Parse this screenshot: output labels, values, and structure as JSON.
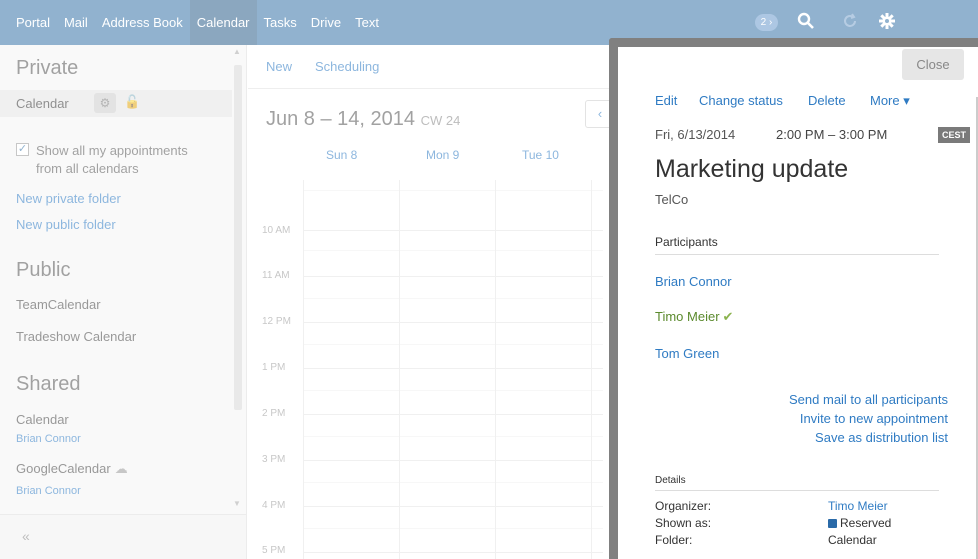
{
  "topbar": {
    "apps": [
      "Portal",
      "Mail",
      "Address Book",
      "Calendar",
      "Tasks",
      "Drive",
      "Text"
    ],
    "active_app": "Calendar",
    "notification_count": "2 ›",
    "icons": [
      "search-icon",
      "refresh-icon",
      "gear-icon"
    ]
  },
  "sidebar": {
    "private_heading": "Private",
    "calendar_label": "Calendar",
    "show_all_label": "Show all my appointments from all calendars",
    "show_all_checked": true,
    "new_private_folder": "New private folder",
    "new_public_folder": "New public folder",
    "public_heading": "Public",
    "public_items": [
      "TeamCalendar",
      "Tradeshow Calendar"
    ],
    "shared_heading": "Shared",
    "shared_items": [
      {
        "name": "Calendar",
        "owner": "Brian Connor"
      },
      {
        "name": "GoogleCalendar",
        "owner": "Brian Connor"
      }
    ],
    "collapse_label": "«"
  },
  "main": {
    "toolbar": {
      "new_label": "New",
      "scheduling_label": "Scheduling"
    },
    "range": "Jun 8 – 14, 2014",
    "cw": "CW 24",
    "days": [
      "Sun 8",
      "Mon 9",
      "Tue 10"
    ],
    "hours": [
      "10 AM",
      "11 AM",
      "12 PM",
      "1 PM",
      "2 PM",
      "3 PM",
      "4 PM",
      "5 PM"
    ],
    "prev_label": "‹"
  },
  "popup": {
    "close_label": "Close",
    "actions": {
      "edit": "Edit",
      "change_status": "Change status",
      "delete": "Delete",
      "more": "More ▾"
    },
    "date": "Fri, 6/13/2014",
    "time": "2:00 PM – 3:00 PM",
    "tz": "CEST",
    "title": "Marketing update",
    "location": "TelCo",
    "participants_heading": "Participants",
    "participants": [
      {
        "name": "Brian Connor",
        "accepted": false
      },
      {
        "name": "Timo Meier",
        "accepted": true
      },
      {
        "name": "Tom Green",
        "accepted": false
      }
    ],
    "links": {
      "send_mail": "Send mail to all participants",
      "invite": "Invite to new appointment",
      "save_list": "Save as distribution list"
    },
    "details_heading": "Details",
    "details": {
      "organizer_label": "Organizer:",
      "organizer_value": "Timo Meier",
      "shown_as_label": "Shown as:",
      "shown_as_value": "Reserved",
      "folder_label": "Folder:",
      "folder_value": "Calendar"
    },
    "reserved_color": "#2a6aa8"
  }
}
